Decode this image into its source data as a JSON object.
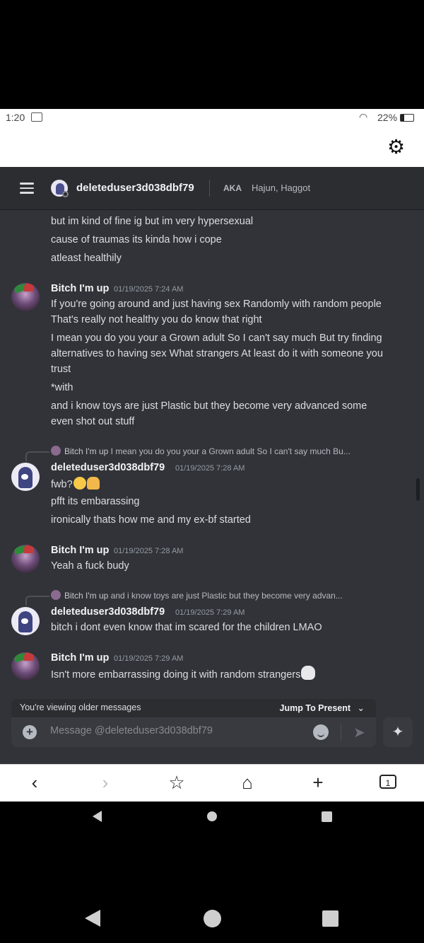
{
  "status_bar": {
    "time": "1:20",
    "battery": "22%"
  },
  "header": {
    "username": "deleteduser3d038dbf79",
    "aka_label": "AKA",
    "aka_names": "Hajun, Haggot"
  },
  "messages": {
    "top_lines": [
      "but im kind of fine ig but im very hypersexual",
      "cause of traumas its kinda how i cope",
      "atleast healthily"
    ],
    "m1": {
      "author": "Bitch I'm up",
      "time": "01/19/2025 7:24 AM",
      "lines": [
        "If you're going around and just having sex Randomly with random people That's really not healthy you do know that right",
        "I mean you do you your a Grown adult So I can't say much But try finding alternatives to having sex What strangers At least do it with someone you trust",
        "*with",
        "and i know toys are just Plastic but they become very advanced some even shot out stuff"
      ]
    },
    "m2": {
      "reply_author": "Bitch I'm up",
      "reply_text": "I mean you do you your a Grown adult So I can't say much Bu...",
      "author": "deleteduser3d038dbf79",
      "time": "01/19/2025 7:28 AM",
      "first_line": "fwb?",
      "lines": [
        "pfft its embarassing",
        "ironically thats how me and my ex-bf started"
      ]
    },
    "m3": {
      "author": "Bitch I'm up",
      "time": "01/19/2025 7:28 AM",
      "text": "Yeah a fuck budy"
    },
    "m4": {
      "reply_author": "Bitch I'm up",
      "reply_text": "and i know toys are just Plastic but they become very advan...",
      "author": "deleteduser3d038dbf79",
      "time": "01/19/2025 7:29 AM",
      "text": "bitch i dont even know that im scared for the children LMAO"
    },
    "m5": {
      "author": "Bitch I'm up",
      "time": "01/19/2025 7:29 AM",
      "text": "Isn't more embarrassing doing it with random strangers"
    }
  },
  "older_banner": {
    "text": "You're viewing older messages",
    "jump": "Jump To Present"
  },
  "composer": {
    "placeholder": "Message @deleteduser3d038dbf79"
  },
  "browser_nav": {
    "tab_count": "1"
  }
}
